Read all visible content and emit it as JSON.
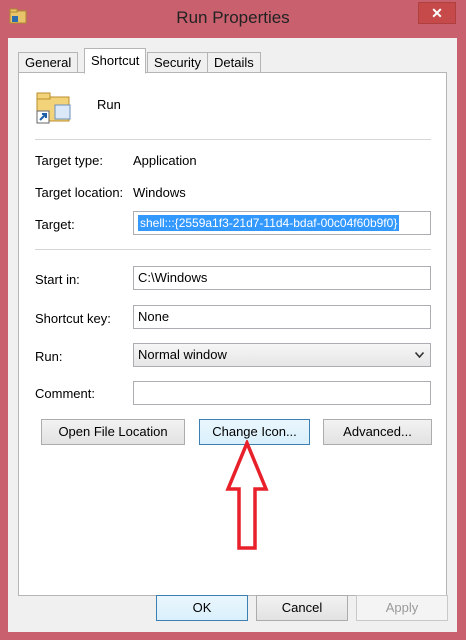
{
  "window": {
    "title": "Run Properties",
    "close_glyph": "✕"
  },
  "tabs": [
    {
      "label": "General"
    },
    {
      "label": "Shortcut"
    },
    {
      "label": "Security"
    },
    {
      "label": "Details"
    }
  ],
  "shortcut": {
    "name": "Run",
    "target_type_label": "Target type:",
    "target_type_value": "Application",
    "target_location_label": "Target location:",
    "target_location_value": "Windows",
    "target_label": "Target:",
    "target_value": "shell:::{2559a1f3-21d7-11d4-bdaf-00c04f60b9f0}",
    "start_in_label": "Start in:",
    "start_in_value": "C:\\Windows",
    "shortcut_key_label": "Shortcut key:",
    "shortcut_key_value": "None",
    "run_label": "Run:",
    "run_value": "Normal window",
    "comment_label": "Comment:",
    "comment_value": "",
    "open_file_location_label": "Open File Location",
    "change_icon_label": "Change Icon...",
    "advanced_label": "Advanced..."
  },
  "footer": {
    "ok_label": "OK",
    "cancel_label": "Cancel",
    "apply_label": "Apply"
  },
  "colors": {
    "frame": "#c8606e",
    "selection": "#3399ff",
    "arrow": "#e8202a"
  }
}
